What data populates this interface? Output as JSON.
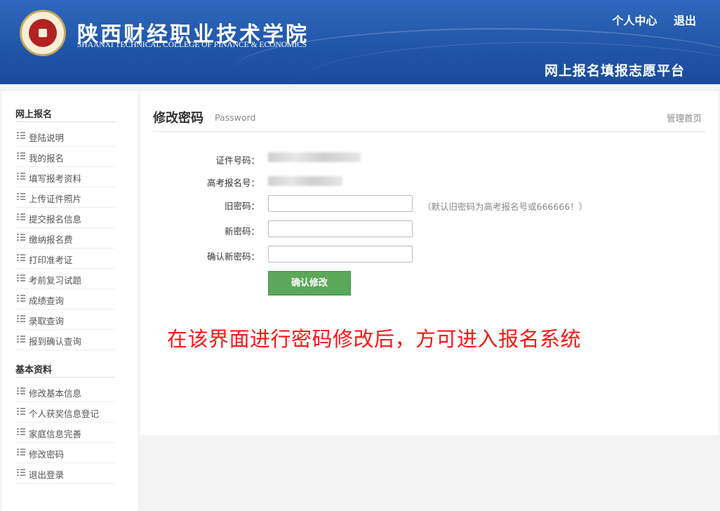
{
  "header": {
    "school_name_cn": "陕西财经职业技术学院",
    "school_name_en": "SHAANXI TECHNICAL COLLEGE OF FINANCE & ECONOMICS",
    "platform_title": "网上报名填报志愿平台",
    "links": [
      "个人中心",
      "退出"
    ]
  },
  "sidebar": {
    "sections": [
      {
        "title": "网上报名",
        "items": [
          "登陆说明",
          "我的报名",
          "填写报考资料",
          "上传证件照片",
          "提交报名信息",
          "缴纳报名费",
          "打印准考证",
          "考前复习试题",
          "成绩查询",
          "录取查询",
          "报到确认查询"
        ]
      },
      {
        "title": "基本资料",
        "items": [
          "修改基本信息",
          "个人获奖信息登记",
          "家庭信息完善",
          "修改密码",
          "退出登录"
        ]
      }
    ]
  },
  "page": {
    "title": "修改密码",
    "subtitle": "Password",
    "home_link": "管理首页"
  },
  "form": {
    "id_label": "证件号码：",
    "exam_label": "高考报名号：",
    "old_pw_label": "旧密码：",
    "old_pw_hint": "（默认旧密码为高考报名号或666666！）",
    "new_pw_label": "新密码：",
    "confirm_pw_label": "确认新密码：",
    "submit_label": "确认修改"
  },
  "annotation": "在该界面进行密码修改后，方可进入报名系统",
  "colors": {
    "header_blue": "#2459ab",
    "button_green": "#5ba85a",
    "annotation_red": "#ff1414"
  }
}
